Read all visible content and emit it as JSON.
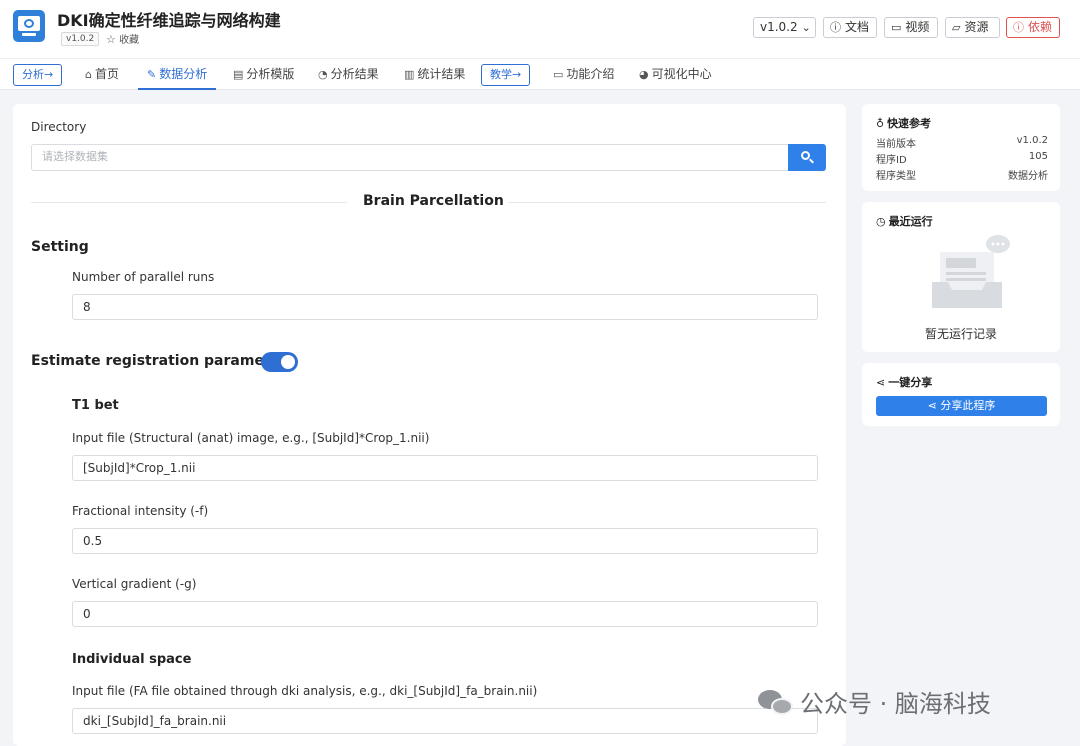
{
  "header": {
    "title": "DKI确定性纤维追踪与网络构建",
    "version_badge": "v1.0.2",
    "favorite_label": "收藏",
    "version_select": "v1.0.2",
    "buttons": {
      "docs": "文档",
      "video": "视频",
      "resources": "资源",
      "dependencies": "依赖"
    }
  },
  "nav": {
    "analysis_pill": "分析→",
    "items": [
      "首页",
      "数据分析",
      "分析模版",
      "分析结果",
      "统计结果"
    ],
    "teaching_pill": "教学→",
    "items2": [
      "功能介绍",
      "可视化中心"
    ],
    "active": "数据分析"
  },
  "form": {
    "directory_label": "Directory",
    "directory_placeholder": "请选择数据集",
    "section_title": "Brain Parcellation",
    "setting_heading": "Setting",
    "parallel_label": "Number of parallel runs",
    "parallel_value": "8",
    "estimate_heading": "Estimate registration parameters",
    "estimate_enabled": true,
    "t1bet_heading": "T1 bet",
    "input_file_label": "Input file (Structural (anat) image, e.g., [SubjId]*Crop_1.nii)",
    "input_file_value": "[SubjId]*Crop_1.nii",
    "frac_label": "Fractional intensity (-f)",
    "frac_value": "0.5",
    "grad_label": "Vertical gradient (-g)",
    "grad_value": "0",
    "individual_heading": "Individual space",
    "fa_label": "Input file (FA file obtained through dki analysis, e.g., dki_[SubjId]_fa_brain.nii)",
    "fa_value": "dki_[SubjId]_fa_brain.nii"
  },
  "quick_ref": {
    "title": "快速参考",
    "rows": [
      {
        "k": "当前版本",
        "v": "v1.0.2"
      },
      {
        "k": "程序ID",
        "v": "105"
      },
      {
        "k": "程序类型",
        "v": "数据分析"
      }
    ]
  },
  "recent": {
    "title": "最近运行",
    "empty": "暂无运行记录"
  },
  "share": {
    "title": "一键分享",
    "button": "分享此程序"
  },
  "watermark": "公众号 · 脑海科技",
  "colors": {
    "accent": "#2f6fd4",
    "primary_button": "#2f80e8",
    "danger": "#e05252"
  }
}
